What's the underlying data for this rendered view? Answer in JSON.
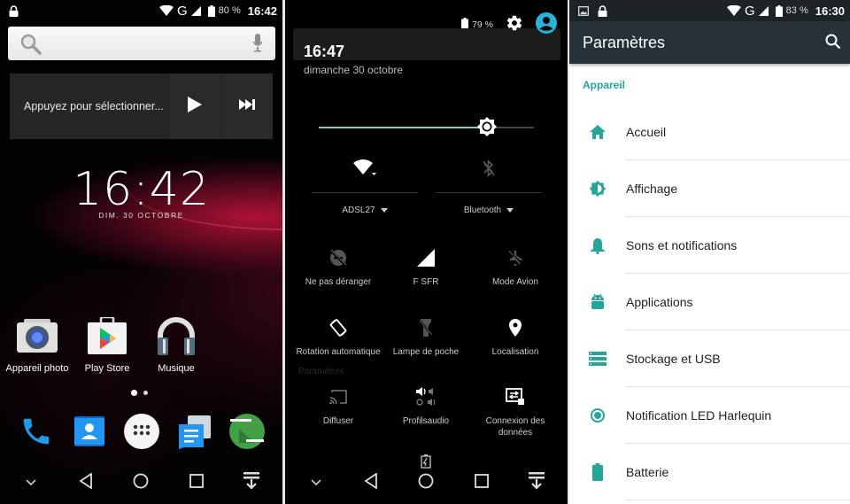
{
  "home_screen": {
    "status_bar": {
      "left_icons": [
        "lock-icon"
      ],
      "right_icons": [
        "wifi-icon",
        "network-type-g",
        "signal-icon",
        "battery-icon"
      ],
      "network_type": "G",
      "battery_percent": "80 %",
      "time": "16:42"
    },
    "search_bar": {
      "search_icon": "search-icon",
      "mic_icon": "mic-icon",
      "placeholder": ""
    },
    "media_notification": {
      "title": "Appuyez pour sélectionner...",
      "buttons": [
        "play-icon",
        "skip-next-icon"
      ]
    },
    "clock": {
      "time": "16:42",
      "date": "DIM. 30 OCTOBRE"
    },
    "apps": [
      {
        "label": "Appareil photo",
        "icon": "camera-icon"
      },
      {
        "label": "Play Store",
        "icon": "play-store-icon"
      },
      {
        "label": "Musique",
        "icon": "headphones-icon"
      }
    ],
    "page_indicator": {
      "pages": 2,
      "current": 1
    },
    "dock": [
      {
        "name": "phone",
        "icon": "phone-icon"
      },
      {
        "name": "contacts",
        "icon": "contacts-icon"
      },
      {
        "name": "all-apps",
        "icon": "app-drawer-icon"
      },
      {
        "name": "messages",
        "icon": "messages-icon"
      },
      {
        "name": "hangouts",
        "icon": "hangouts-icon"
      }
    ],
    "nav_bar": [
      "chevron-down-icon",
      "back-icon",
      "home-icon",
      "recents-icon",
      "notification-pull-icon"
    ]
  },
  "quick_settings": {
    "header": {
      "battery_percent": "79 %",
      "settings_icon": "gear-icon",
      "user_icon": "account-icon"
    },
    "time": "16:47",
    "date": "dimanche 30 octobre",
    "brightness": {
      "level_fraction": 0.78
    },
    "big_tiles": [
      {
        "label": "ADSL27",
        "icon": "wifi-icon",
        "active": true
      },
      {
        "label": "Bluetooth",
        "icon": "bluetooth-off-icon",
        "active": false
      }
    ],
    "tiles": [
      {
        "label": "Ne pas déranger",
        "icon": "do-not-disturb-off-icon",
        "active": false
      },
      {
        "label": "F SFR",
        "icon": "signal-icon",
        "active": true
      },
      {
        "label": "Mode Avion",
        "icon": "airplane-off-icon",
        "active": false
      },
      {
        "label": "Rotation automatique",
        "icon": "screen-rotation-icon",
        "active": true
      },
      {
        "label": "Lampe de poche",
        "icon": "flashlight-off-icon",
        "active": false
      },
      {
        "label": "Localisation",
        "icon": "location-icon",
        "active": true
      },
      {
        "label": "Diffuser",
        "icon": "cast-icon",
        "active": false
      },
      {
        "label": "Profilsaudio",
        "icon": "audio-profiles-icon",
        "active": false
      },
      {
        "label": "Connexion des données",
        "icon": "data-connection-icon",
        "active": true
      }
    ],
    "ghost_label": "Paramètres",
    "footer_icon": "battery-charging-icon",
    "nav_bar": [
      "chevron-down-icon",
      "back-icon",
      "home-icon",
      "recents-icon",
      "notification-pull-icon"
    ]
  },
  "settings": {
    "status_bar": {
      "left_icons": [
        "image-icon",
        "lock-icon"
      ],
      "network_type": "G",
      "battery_percent": "83 %",
      "time": "16:30"
    },
    "toolbar": {
      "title": "Paramètres",
      "search_icon": "search-icon"
    },
    "category": "Appareil",
    "items": [
      {
        "label": "Accueil",
        "icon": "home-icon"
      },
      {
        "label": "Affichage",
        "icon": "brightness-icon"
      },
      {
        "label": "Sons et notifications",
        "icon": "bell-icon"
      },
      {
        "label": "Applications",
        "icon": "android-icon"
      },
      {
        "label": "Stockage et USB",
        "icon": "storage-icon"
      },
      {
        "label": "Notification LED Harlequin",
        "icon": "led-icon"
      },
      {
        "label": "Batterie",
        "icon": "battery-icon"
      }
    ],
    "colors": {
      "accent": "#26a69a",
      "toolbar": "#263238",
      "status_bar": "#1d2327"
    }
  }
}
